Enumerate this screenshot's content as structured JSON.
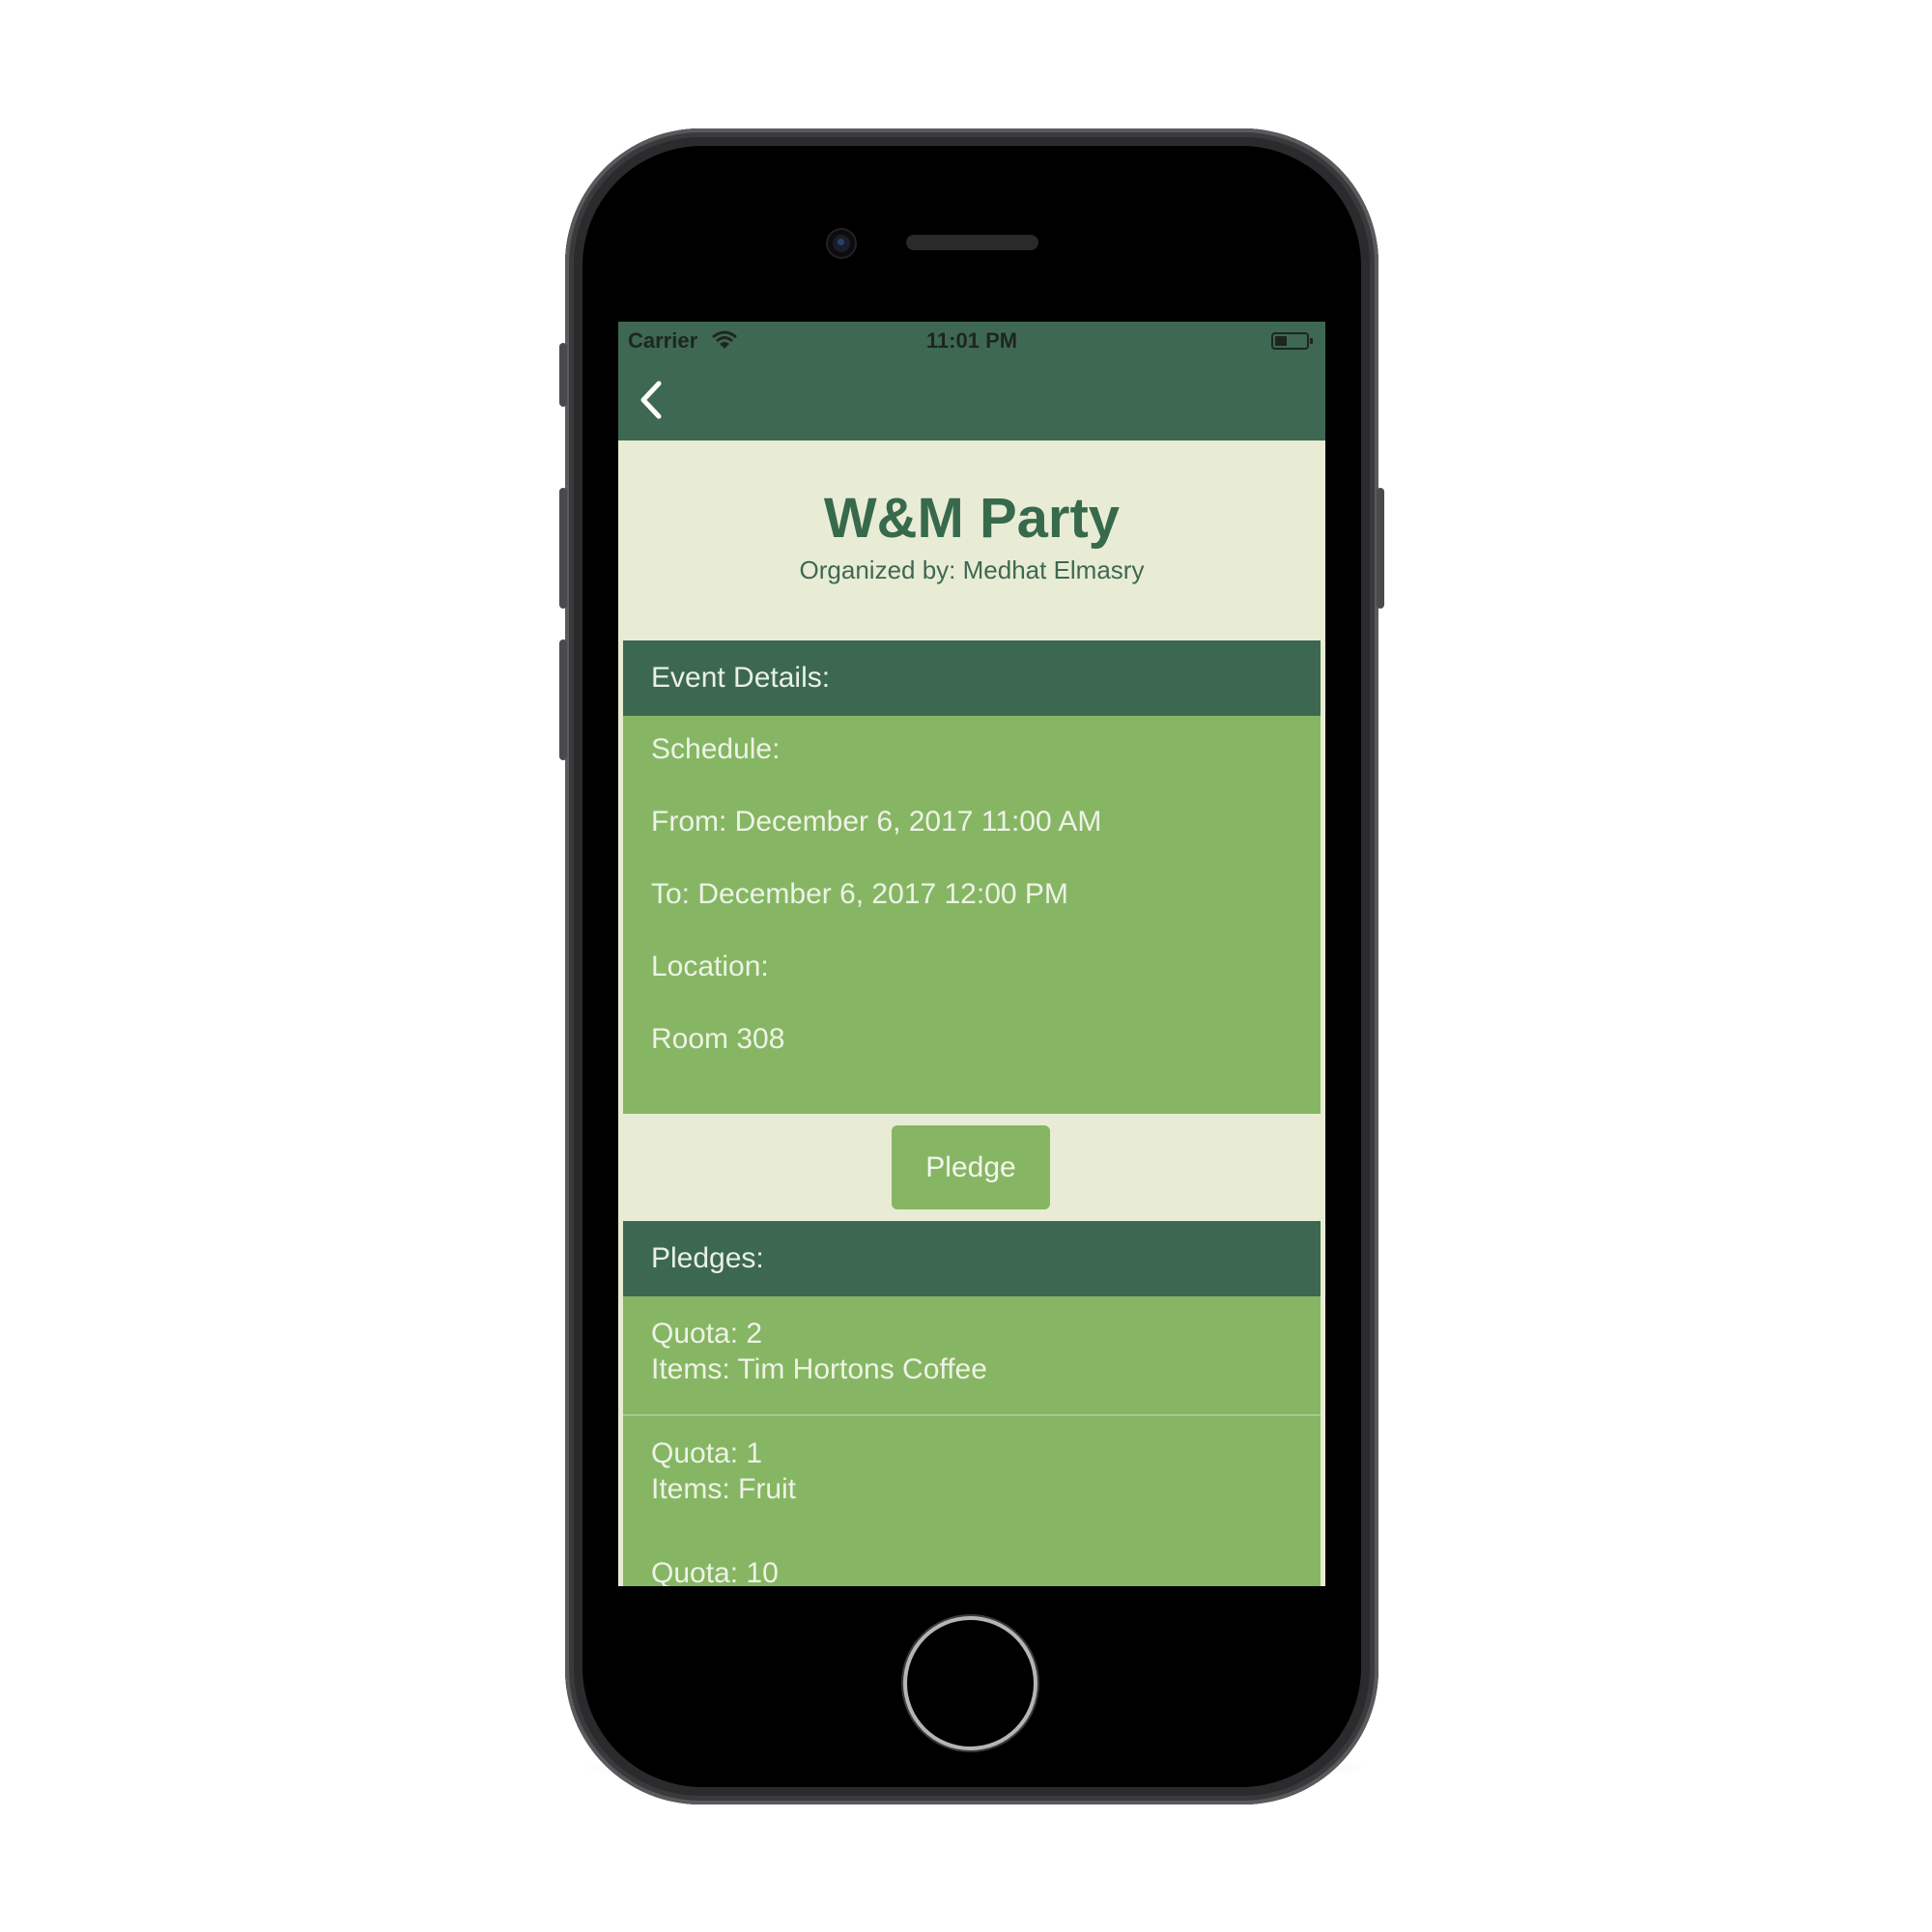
{
  "status_bar": {
    "carrier": "Carrier",
    "time": "11:01 PM"
  },
  "nav": {
    "back_icon": "chevron-left-icon"
  },
  "event": {
    "title": "W&M Party",
    "organizer": "Organized by: Medhat Elmasry"
  },
  "details": {
    "header": "Event Details:",
    "schedule_label": "Schedule:",
    "from": "From: December 6, 2017 11:00 AM",
    "to": "To: December 6, 2017 12:00 PM",
    "location_label": "Location:",
    "location": "Room 308"
  },
  "pledge_button": {
    "label": "Pledge"
  },
  "pledges": {
    "header": "Pledges:",
    "items": [
      {
        "quota": "Quota: 2",
        "items": "Items: Tim Hortons Coffee"
      },
      {
        "quota": "Quota: 1",
        "items": "Items: Fruit"
      },
      {
        "quota": "Quota: 10"
      }
    ]
  },
  "colors": {
    "nav_green": "#3e6852",
    "header_green": "#3c6852",
    "card_green": "#86b663",
    "background_cream": "#e9ecd5",
    "title_green": "#376a4c"
  }
}
